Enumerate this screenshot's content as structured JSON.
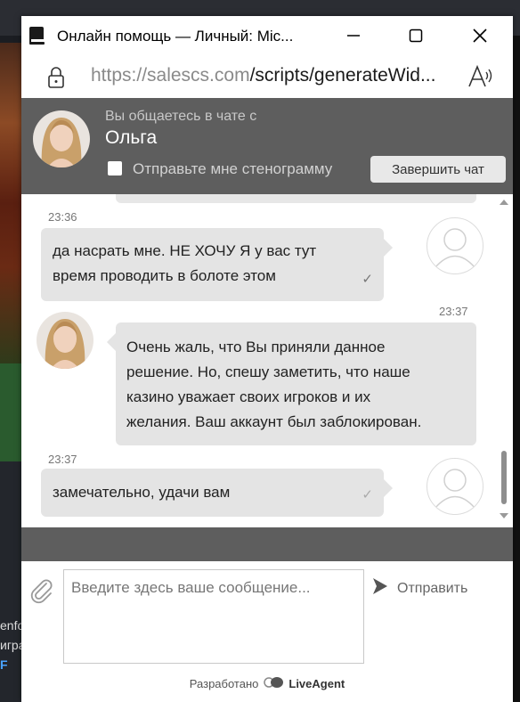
{
  "background": {
    "fragments": [
      "enfo",
      "игра",
      "F"
    ]
  },
  "window": {
    "title": "Онлайн помощь — Личный: Mic...",
    "url_domain": "https://salescs.com",
    "url_path": "/scripts/generateWid...",
    "icons": [
      "book-icon",
      "minimize-icon",
      "maximize-icon",
      "close-icon",
      "lock-icon",
      "read-aloud-icon"
    ]
  },
  "header": {
    "subtitle": "Вы общаетесь в чате с",
    "agent_name": "Ольга",
    "transcript_label": "Отправьте мне стенограмму",
    "transcript_checked": false,
    "end_chat_label": "Завершить чат"
  },
  "messages": [
    {
      "from": "user",
      "time": "23:36",
      "text_line1": "да насрать мне. НЕ ХОЧУ Я у вас тут",
      "text_line2": "время проводить в болоте этом",
      "status": "✓"
    },
    {
      "from": "agent",
      "time": "23:37",
      "line1": "Очень жаль, что Вы приняли данное",
      "line2": "решение. Но, спешу заметить, что наше",
      "line3": "казино уважает своих игроков и их",
      "line4": "желания. Ваш аккаунт был заблокирован."
    },
    {
      "from": "user",
      "time": "23:37",
      "text_line1": "замечательно, удачи вам",
      "status": "✓"
    }
  ],
  "composer": {
    "placeholder": "Введите здесь ваше сообщение...",
    "value": "",
    "send_label": "Отправить"
  },
  "footer": {
    "powered_label": "Разработано",
    "brand": "LiveAgent"
  },
  "colors": {
    "header_bg": "#5e5e5e",
    "bubble_bg": "#e4e4e4",
    "end_button_bg": "#e8e8e8"
  }
}
